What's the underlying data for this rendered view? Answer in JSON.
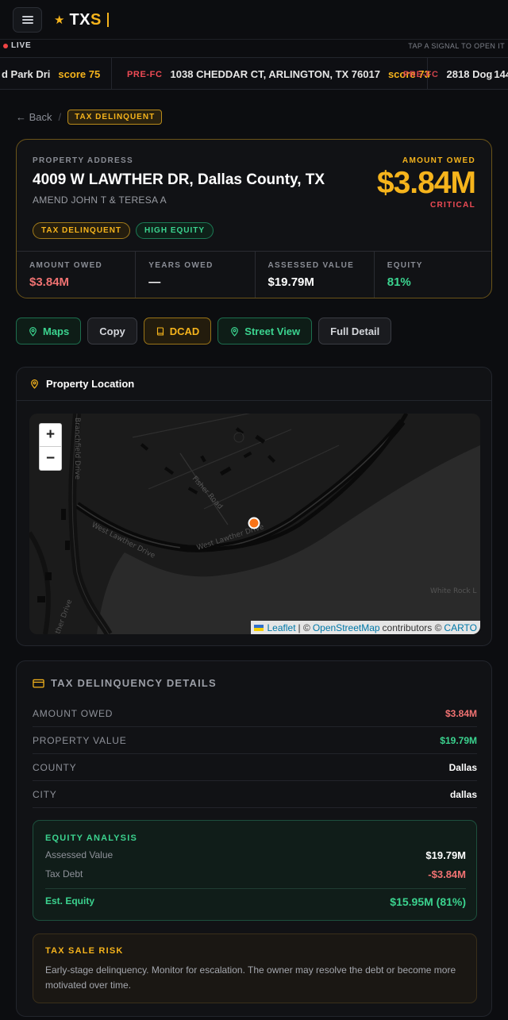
{
  "header": {
    "logo_prefix": "TX",
    "logo_accent": "S",
    "live_label": "LIVE",
    "tap_hint": "TAP A SIGNAL TO OPEN IT"
  },
  "ticker": [
    {
      "tag": "",
      "address": "d Park Dri",
      "score": "score 75"
    },
    {
      "tag": "PRE-FC",
      "address": "1038 CHEDDAR CT, ARLINGTON, TX 76017",
      "score": "score 73"
    },
    {
      "tag": "PRE-FC",
      "address": "2818 Dog",
      "score": "144"
    }
  ],
  "breadcrumb": {
    "back": "← Back",
    "sep": "/",
    "current": "TAX DELINQUENT"
  },
  "property": {
    "address_label": "PROPERTY ADDRESS",
    "address": "4009 W LAWTHER DR, Dallas County, TX",
    "owner": "AMEND JOHN T & TERESA A",
    "tags": [
      "TAX DELINQUENT",
      "HIGH EQUITY"
    ],
    "amount_owed_label": "AMOUNT OWED",
    "amount_owed": "$3.84M",
    "severity": "CRITICAL"
  },
  "stats": [
    {
      "label": "AMOUNT OWED",
      "value": "$3.84M",
      "color": "#f07272"
    },
    {
      "label": "YEARS OWED",
      "value": "—",
      "color": "#ffffff"
    },
    {
      "label": "ASSESSED VALUE",
      "value": "$19.79M",
      "color": "#ffffff"
    },
    {
      "label": "EQUITY",
      "value": "81%",
      "color": "#3bd38f"
    }
  ],
  "actions": {
    "maps": "Maps",
    "copy": "Copy",
    "dcad": "DCAD",
    "street_view": "Street View",
    "full_detail": "Full Detail"
  },
  "map": {
    "title": "Property Location",
    "zoom_in": "+",
    "zoom_out": "−",
    "streets": [
      "Branchfield Drive",
      "Fisher Road",
      "West Lawther Drive",
      "West Lawther Drive",
      "White Rock L",
      "ther Drive"
    ],
    "attr_leaflet": "Leaflet",
    "attr_sep": "| ©",
    "attr_osm": "OpenStreetMap",
    "attr_contrib": "contributors ©",
    "attr_carto": "CARTO"
  },
  "details": {
    "title": "TAX DELINQUENCY DETAILS",
    "rows": [
      {
        "key": "AMOUNT OWED",
        "value": "$3.84M",
        "color": "#f07272"
      },
      {
        "key": "PROPERTY VALUE",
        "value": "$19.79M",
        "color": "#3bd38f"
      },
      {
        "key": "COUNTY",
        "value": "Dallas",
        "color": "#ffffff"
      },
      {
        "key": "CITY",
        "value": "dallas",
        "color": "#ffffff"
      }
    ],
    "equity": {
      "title": "EQUITY ANALYSIS",
      "assessed_label": "Assessed Value",
      "assessed_value": "$19.79M",
      "debt_label": "Tax Debt",
      "debt_value": "-$3.84M",
      "est_label": "Est. Equity",
      "est_value": "$15.95M (81%)"
    },
    "risk": {
      "title": "TAX SALE RISK",
      "text": "Early-stage delinquency. Monitor for escalation. The owner may resolve the debt or become more motivated over time."
    }
  }
}
